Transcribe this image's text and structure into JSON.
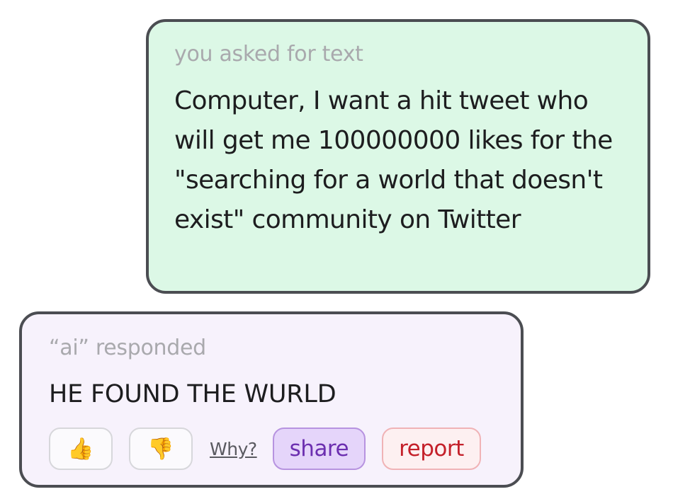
{
  "user_message": {
    "caption": "you asked for text",
    "text": "Computer, I want a hit tweet who will get me 100000000 likes for the \"searching for a world that doesn't exist\" community on Twitter",
    "background": "#dcf8e6"
  },
  "ai_message": {
    "caption": "“ai” responded",
    "text": "HE FOUND THE WURLD",
    "background": "#f7f2fc"
  },
  "actions": {
    "thumbs_up": {
      "icon": "thumbs-up-icon",
      "glyph": "👍"
    },
    "thumbs_down": {
      "icon": "thumbs-down-icon",
      "glyph": "👎"
    },
    "why_label": "Why?",
    "share_label": "share",
    "report_label": "report"
  },
  "colors": {
    "border": "#4b4d52",
    "share": "#6c2fb0",
    "report": "#c4202a"
  }
}
